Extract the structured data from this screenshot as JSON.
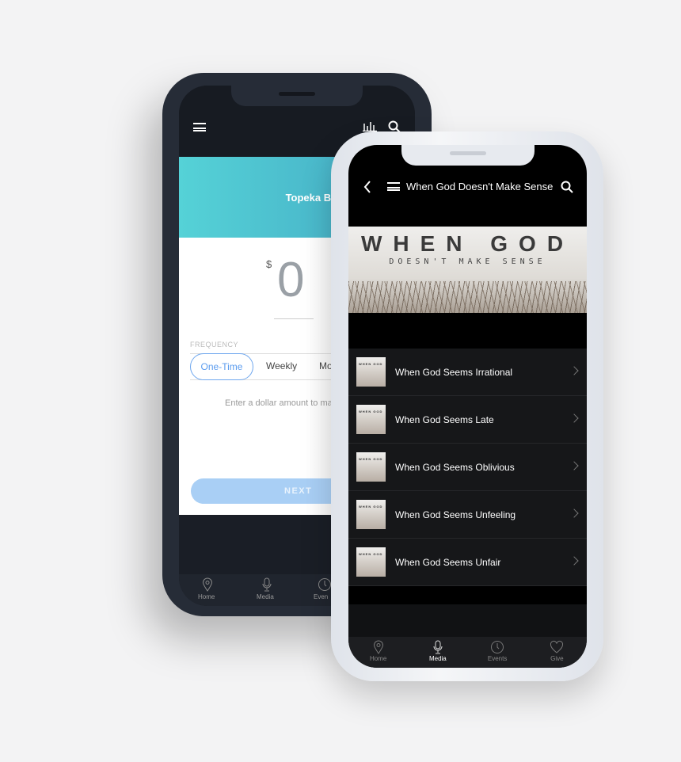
{
  "back_phone": {
    "church_name": "Topeka Bible Chu",
    "currency_symbol": "$",
    "amount": "0",
    "frequency_label": "FREQUENCY",
    "frequency_options": [
      "One-Time",
      "Weekly",
      "Mo"
    ],
    "selected_frequency": "One-Time",
    "hint": "Enter a dollar amount to ma",
    "next_label": "NEXT",
    "tabs": [
      "Home",
      "Media",
      "Even"
    ]
  },
  "front_phone": {
    "title": "When God Doesn't Make Sense",
    "banner": {
      "line1": "WHEN GOD",
      "line2": "DOESN'T MAKE SENSE"
    },
    "thumb_text": "WHEN GOD",
    "items": [
      "When God Seems Irrational",
      "When God Seems Late",
      "When God Seems Oblivious",
      "When God Seems Unfeeling",
      "When God Seems Unfair"
    ],
    "tabs": [
      "Home",
      "Media",
      "Events",
      "Give"
    ],
    "active_tab": "Media"
  },
  "colors": {
    "teal": "#55d2d7",
    "accent_blue": "#5b9cef",
    "next_button": "#a9cff5"
  }
}
